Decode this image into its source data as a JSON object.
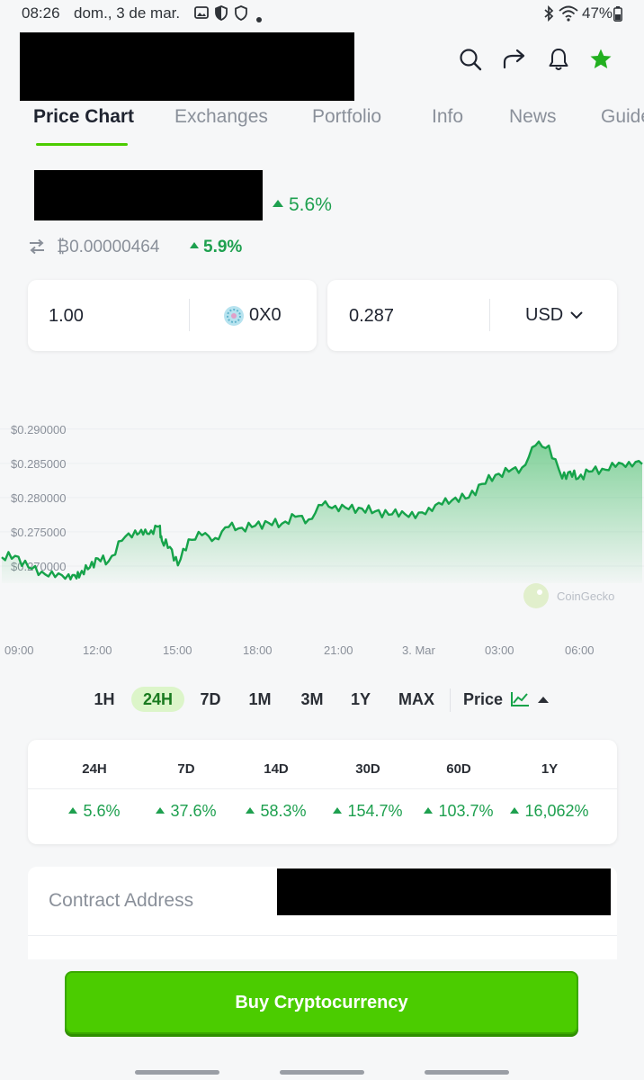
{
  "status_bar": {
    "time": "08:26",
    "date": "dom., 3 de mar.",
    "battery": "47%"
  },
  "header": {
    "icons": [
      "search-icon",
      "share-icon",
      "bell-icon",
      "star-icon"
    ]
  },
  "tabs": [
    {
      "label": "Price Chart",
      "active": true
    },
    {
      "label": "Exchanges"
    },
    {
      "label": "Portfolio"
    },
    {
      "label": "Info"
    },
    {
      "label": "News"
    },
    {
      "label": "Guide"
    }
  ],
  "price": {
    "change_24h": "5.6%",
    "btc_price": "₿0.00000464",
    "btc_change": "5.9%"
  },
  "converter": {
    "amount": "1.00",
    "token_symbol": "0X0",
    "fiat_value": "0.287",
    "currency": "USD"
  },
  "chart_data": {
    "type": "area",
    "y_ticks": [
      "$0.290000",
      "$0.285000",
      "$0.280000",
      "$0.275000",
      "$0.270000"
    ],
    "x_ticks": [
      "09:00",
      "12:00",
      "15:00",
      "18:00",
      "21:00",
      "3. Mar",
      "03:00",
      "06:00"
    ],
    "ylim": [
      0.2675,
      0.2905
    ],
    "watermark": "CoinGecko",
    "line_color": "#16a34a",
    "x": [
      0,
      0.5,
      1,
      1.5,
      2,
      2.5,
      2.8,
      3,
      3.3,
      3.6,
      4,
      4.5,
      5,
      5.3,
      5.6,
      5.9,
      6,
      6.3,
      6.6,
      7,
      7.5,
      8,
      8.5,
      9,
      9.5,
      10,
      10.5,
      11,
      11.5,
      12,
      12.5,
      13,
      13.5,
      14,
      14.5,
      15,
      15.5,
      16,
      16.5,
      17,
      17.5,
      18,
      18.5,
      19,
      19.5,
      20,
      20.5,
      21,
      21.3,
      21.6,
      22,
      22.5,
      23,
      23.5,
      24
    ],
    "y": [
      0.2713,
      0.2715,
      0.2698,
      0.2692,
      0.2684,
      0.2688,
      0.2682,
      0.2693,
      0.2698,
      0.2711,
      0.2707,
      0.2737,
      0.2752,
      0.2746,
      0.2752,
      0.2758,
      0.2737,
      0.2728,
      0.2701,
      0.2739,
      0.2745,
      0.2741,
      0.2757,
      0.2756,
      0.2759,
      0.2763,
      0.2762,
      0.2772,
      0.2768,
      0.2789,
      0.2788,
      0.2783,
      0.2784,
      0.278,
      0.2775,
      0.278,
      0.277,
      0.2785,
      0.279,
      0.28,
      0.28,
      0.282,
      0.2833,
      0.2838,
      0.2844,
      0.2876,
      0.2876,
      0.2828,
      0.2838,
      0.2828,
      0.2838,
      0.2842,
      0.2845,
      0.2852,
      0.2849
    ]
  },
  "ranges": [
    {
      "label": "1H"
    },
    {
      "label": "24H",
      "active": true
    },
    {
      "label": "7D"
    },
    {
      "label": "1M"
    },
    {
      "label": "3M"
    },
    {
      "label": "1Y"
    },
    {
      "label": "MAX"
    }
  ],
  "chart_type_label": "Price",
  "performance": {
    "headers": [
      "24H",
      "7D",
      "14D",
      "30D",
      "60D",
      "1Y"
    ],
    "values": [
      "5.6%",
      "37.6%",
      "58.3%",
      "154.7%",
      "103.7%",
      "16,062%"
    ]
  },
  "contract": {
    "label": "Contract Address"
  },
  "buy_button": "Buy Cryptocurrency"
}
